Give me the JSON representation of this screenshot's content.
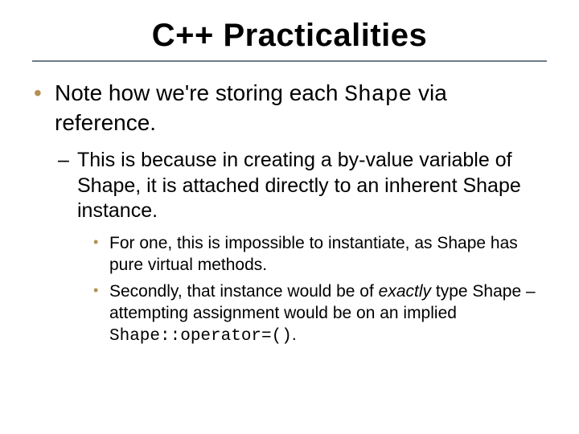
{
  "title": "C++ Practicalities",
  "b1_a": "Note how we're storing each ",
  "b1_code": "Shape",
  "b1_b": " via reference.",
  "b2": "This is because in creating a by-value variable of Shape, it is attached directly to an inherent Shape instance.",
  "b3": "For one, this is impossible to instantiate, as Shape has pure virtual methods.",
  "b4_a": "Secondly, that instance would be of ",
  "b4_em": "exactly",
  "b4_b": " type Shape – attempting assignment would be on an implied ",
  "b4_code": "Shape::operator=()",
  "b4_c": "."
}
